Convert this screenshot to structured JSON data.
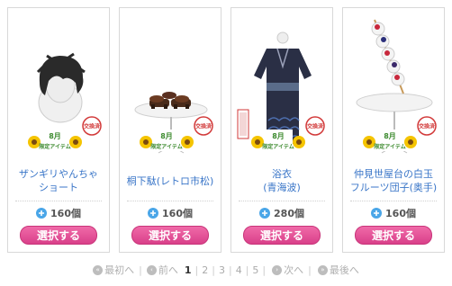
{
  "items": [
    {
      "name_lines": [
        "ザンギリやんちゃ",
        "ショート"
      ],
      "price": "160個",
      "button": "選択する",
      "badges": {
        "month": "8月",
        "limited": "限定アイテム",
        "stamp": "交換済"
      }
    },
    {
      "name_lines": [
        "桐下駄(レトロ市松)"
      ],
      "price": "160個",
      "button": "選択する",
      "badges": {
        "month": "8月",
        "limited": "限定アイテム",
        "stamp": "交換済"
      }
    },
    {
      "name_lines": [
        "浴衣",
        "(青海波)"
      ],
      "price": "280個",
      "button": "選択する",
      "badges": {
        "month": "8月",
        "limited": "限定アイテム",
        "stamp": "交換済"
      }
    },
    {
      "name_lines": [
        "仲見世屋台の白玉",
        "フルーツ団子(奥手)"
      ],
      "price": "160個",
      "button": "選択する",
      "badges": {
        "month": "8月",
        "limited": "限定アイテム",
        "stamp": "交換済"
      }
    }
  ],
  "pagination": {
    "first": "最初へ",
    "prev": "前へ",
    "pages": [
      "1",
      "2",
      "3",
      "4",
      "5"
    ],
    "current": "1",
    "next": "次へ",
    "last": "最後へ"
  },
  "colors": {
    "accent_pink": "#e0508f",
    "link_blue": "#3a76c8",
    "price_icon": "#4aa6e8"
  },
  "icons": {
    "price": "plus-circle-icon",
    "first": "double-left-chevron-icon",
    "prev": "left-chevron-icon",
    "next": "right-chevron-icon",
    "last": "double-right-chevron-icon"
  }
}
